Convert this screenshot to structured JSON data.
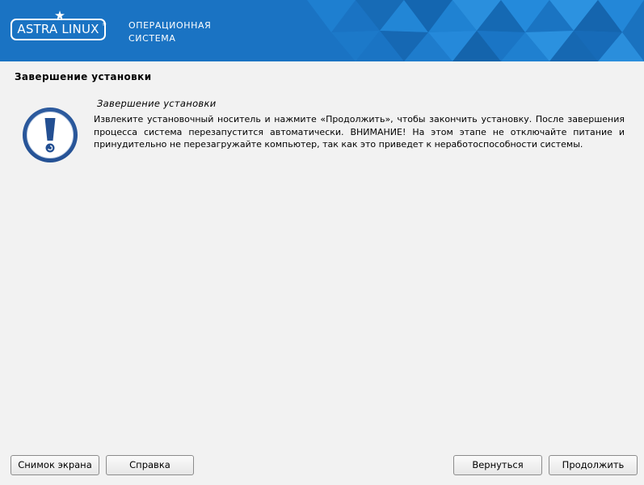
{
  "header": {
    "logo_text": "ASTRA LINUX",
    "logo_registered": "®",
    "subtitle_line1": "ОПЕРАЦИОННАЯ",
    "subtitle_line2": "СИСТЕМА"
  },
  "page": {
    "title": "Завершение установки"
  },
  "message": {
    "icon": "warning-exclamation-icon",
    "heading": "Завершение установки",
    "body": "Извлеките установочный носитель и нажмите «Продолжить», чтобы закончить установку. После завершения процесса система перезапустится автоматически. ВНИМАНИЕ! На этом этапе не отключайте питание и принудительно не перезагружайте компьютер, так как это приведет к неработоспособности системы."
  },
  "buttons": {
    "screenshot": "Снимок экрана",
    "help": "Справка",
    "back": "Вернуться",
    "continue": "Продолжить"
  },
  "colors": {
    "header_blue": "#1b74c4",
    "icon_blue": "#2b5ea5"
  }
}
